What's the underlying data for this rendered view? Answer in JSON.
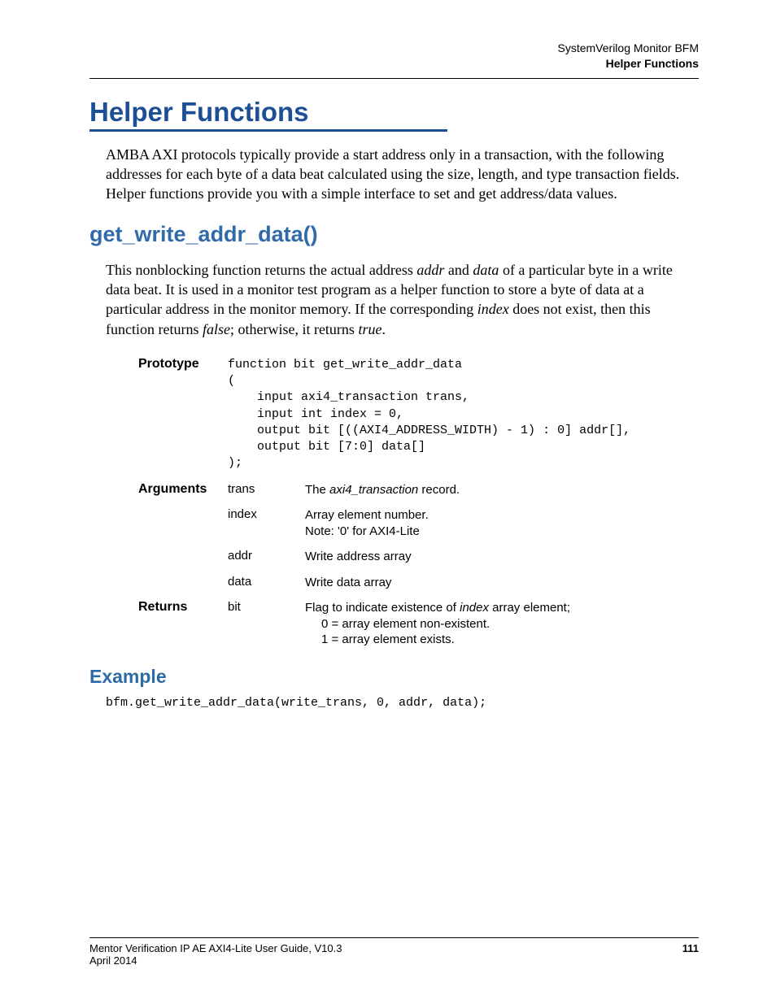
{
  "header": {
    "line1": "SystemVerilog Monitor BFM",
    "line2": "Helper Functions"
  },
  "title": "Helper Functions",
  "intro": "AMBA AXI protocols typically provide a start address only in a transaction, with the following addresses for each byte of a data  beat calculated using the size, length, and type transaction fields. Helper functions provide you with a simple interface to set and get address/data values.",
  "func_title": "get_write_addr_data()",
  "func_desc_parts": {
    "p1": "This nonblocking function returns the actual address ",
    "addr": "addr",
    "p2": " and ",
    "data": "data",
    "p3": " of a particular byte in a write data  beat. It is used in a monitor test program as a helper function to store a byte of data at a particular address in the monitor memory. If the corresponding ",
    "index": "index",
    "p4": " does not exist, then this function returns ",
    "false": "false",
    "p5": "; otherwise, it returns ",
    "true": "true",
    "p6": "."
  },
  "prototype": {
    "label": "Prototype",
    "code": "function bit get_write_addr_data\n(\n    input axi4_transaction trans,\n    input int index = 0,\n    output bit [((AXI4_ADDRESS_WIDTH) - 1) : 0] addr[],\n    output bit [7:0] data[]\n);"
  },
  "arguments": {
    "label": "Arguments",
    "rows": [
      {
        "name": "trans",
        "desc_pre": "The ",
        "desc_it": "axi4_transaction",
        "desc_post": " record."
      },
      {
        "name": "index",
        "desc_l1": "Array element number.",
        "desc_l2": "Note: '0' for AXI4-Lite"
      },
      {
        "name": "addr",
        "desc": "Write address array"
      },
      {
        "name": "data",
        "desc": "Write data array"
      }
    ]
  },
  "returns": {
    "label": "Returns",
    "name": "bit",
    "desc_pre": "Flag to indicate existence of ",
    "desc_it": "index",
    "desc_post": " array element;",
    "l2": "0 = array element non-existent.",
    "l3": "1 = array element exists."
  },
  "example": {
    "title": "Example",
    "code": "bfm.get_write_addr_data(write_trans, 0, addr, data);"
  },
  "footer": {
    "left": "Mentor Verification IP AE AXI4-Lite User Guide, V10.3",
    "date": "April 2014",
    "page": "111"
  }
}
